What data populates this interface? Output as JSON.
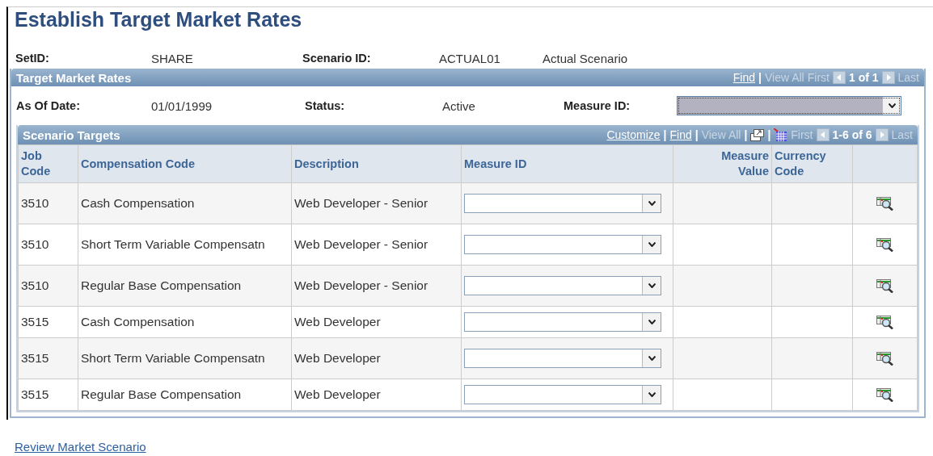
{
  "page_title": "Establish Target Market Rates",
  "header_fields": [
    {
      "label": "SetID:",
      "value": "SHARE"
    },
    {
      "label": "Scenario ID:",
      "value": "ACTUAL01",
      "extra": "Actual Scenario"
    }
  ],
  "rates_panel": {
    "title": "Target Market Rates",
    "nav": [
      {
        "kind": "link",
        "label": "Find"
      },
      {
        "kind": "sep",
        "label": "|"
      },
      {
        "kind": "disabled",
        "label": "View All"
      },
      {
        "kind": "disabled",
        "label": "First"
      },
      {
        "kind": "prev"
      },
      {
        "kind": "count",
        "label": "1 of 1"
      },
      {
        "kind": "next"
      },
      {
        "kind": "disabled",
        "label": "Last"
      }
    ],
    "fields": [
      {
        "label": "As Of Date:",
        "value": "01/01/1999"
      },
      {
        "label": "Status:",
        "value": "Active"
      }
    ],
    "measure_select": {
      "label": "Measure ID:",
      "focused": true
    },
    "grid": {
      "title": "Scenario Targets",
      "nav": [
        {
          "kind": "link",
          "label": "Customize"
        },
        {
          "kind": "sep",
          "label": "|"
        },
        {
          "kind": "link",
          "label": "Find"
        },
        {
          "kind": "sep",
          "label": "|"
        },
        {
          "kind": "disabled",
          "label": "View All"
        },
        {
          "kind": "sep",
          "label": "|"
        },
        {
          "kind": "zoom"
        },
        {
          "kind": "sep",
          "label": "|"
        },
        {
          "kind": "download"
        },
        {
          "kind": "disabled",
          "label": "First"
        },
        {
          "kind": "prev"
        },
        {
          "kind": "count",
          "label": "1-6 of 6"
        },
        {
          "kind": "next"
        },
        {
          "kind": "disabled",
          "label": "Last"
        }
      ],
      "columns": [
        {
          "label": "Job Code"
        },
        {
          "label": "Compensation Code"
        },
        {
          "label": "Description"
        },
        {
          "label": "Measure ID"
        },
        {
          "label": "Measure Value"
        },
        {
          "label": "Currency Code"
        },
        {}
      ],
      "rows": [
        {
          "job_code": "3510",
          "compensation_code": "Cash Compensation",
          "description": "Web Developer - Senior"
        },
        {
          "job_code": "3510",
          "compensation_code": "Short Term Variable Compensatn",
          "description": "Web Developer - Senior"
        },
        {
          "job_code": "3510",
          "compensation_code": "Regular Base Compensation",
          "description": "Web Developer - Senior"
        },
        {
          "job_code": "3515",
          "compensation_code": "Cash Compensation",
          "description": "Web Developer"
        },
        {
          "job_code": "3515",
          "compensation_code": "Short Term Variable Compensatn",
          "description": "Web Developer"
        },
        {
          "job_code": "3515",
          "compensation_code": "Regular Base Compensation",
          "description": "Web Developer"
        }
      ]
    }
  },
  "footer_link": "Review Market Scenario"
}
